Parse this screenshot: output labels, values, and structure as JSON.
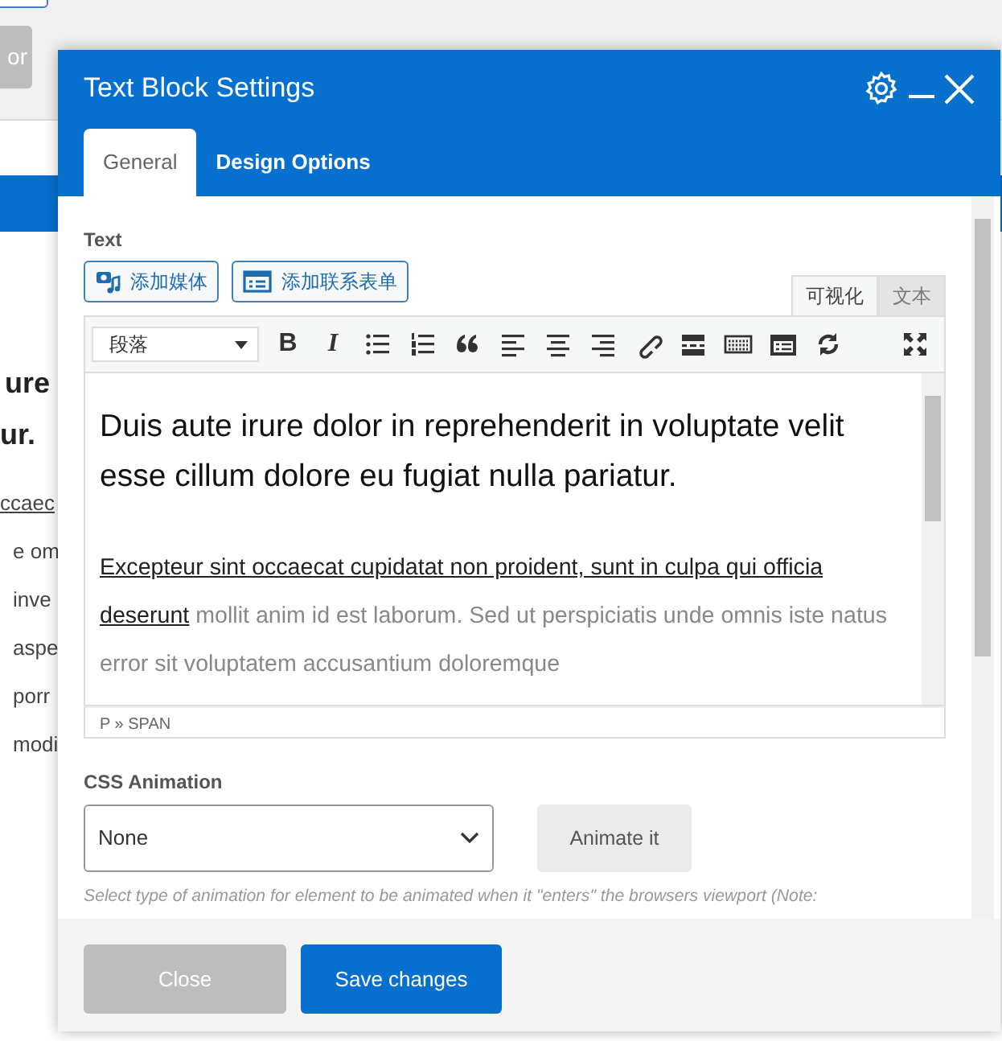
{
  "background_page": {
    "button": "or",
    "heading_lines": [
      "ure",
      "ur."
    ],
    "text_lines": [
      {
        "text": "ccaec",
        "kind": "link"
      },
      {
        "text": "e om",
        "kind": "plain"
      },
      {
        "text": "inve",
        "kind": "plain"
      },
      {
        "text": "aspe",
        "kind": "plain"
      },
      {
        "text": "porr",
        "kind": "plain"
      },
      {
        "text": "modi",
        "kind": "plain"
      }
    ]
  },
  "modal": {
    "title": "Text Block Settings",
    "tabs": [
      {
        "label": "General",
        "selected": true
      },
      {
        "label": "Design Options",
        "selected": false
      }
    ],
    "text_label": "Text",
    "media_buttons": [
      {
        "label": "添加媒体",
        "kind": "media"
      },
      {
        "label": "添加联系表单",
        "kind": "form"
      }
    ],
    "editor_tabs": [
      {
        "label": "可视化",
        "selected": true
      },
      {
        "label": "文本",
        "selected": false
      }
    ],
    "format_select": "段落",
    "format_buttons": [
      {
        "label": "B",
        "kind": "bold"
      },
      {
        "label": "I",
        "kind": "italic"
      }
    ],
    "content": {
      "heading": "Duis aute irure dolor in reprehenderit in voluptate velit esse cillum dolore eu fugiat nulla pariatur.",
      "link_text": "Excepteur sint occaecat cupidatat non proident, sunt in culpa qui officia deserunt",
      "text": "mollit anim id est laborum. Sed ut perspiciatis unde omnis iste natus error sit voluptatem accusantium doloremque"
    },
    "path": "P » SPAN",
    "animation_label": "CSS Animation",
    "animation_select": "None",
    "animate_button": "Animate it",
    "hint": "Select type of animation for element to be animated when it \"enters\" the browsers viewport (Note:",
    "footer_buttons": [
      {
        "label": "Close",
        "kind": "secondary"
      },
      {
        "label": "Save changes",
        "kind": "primary"
      }
    ]
  }
}
